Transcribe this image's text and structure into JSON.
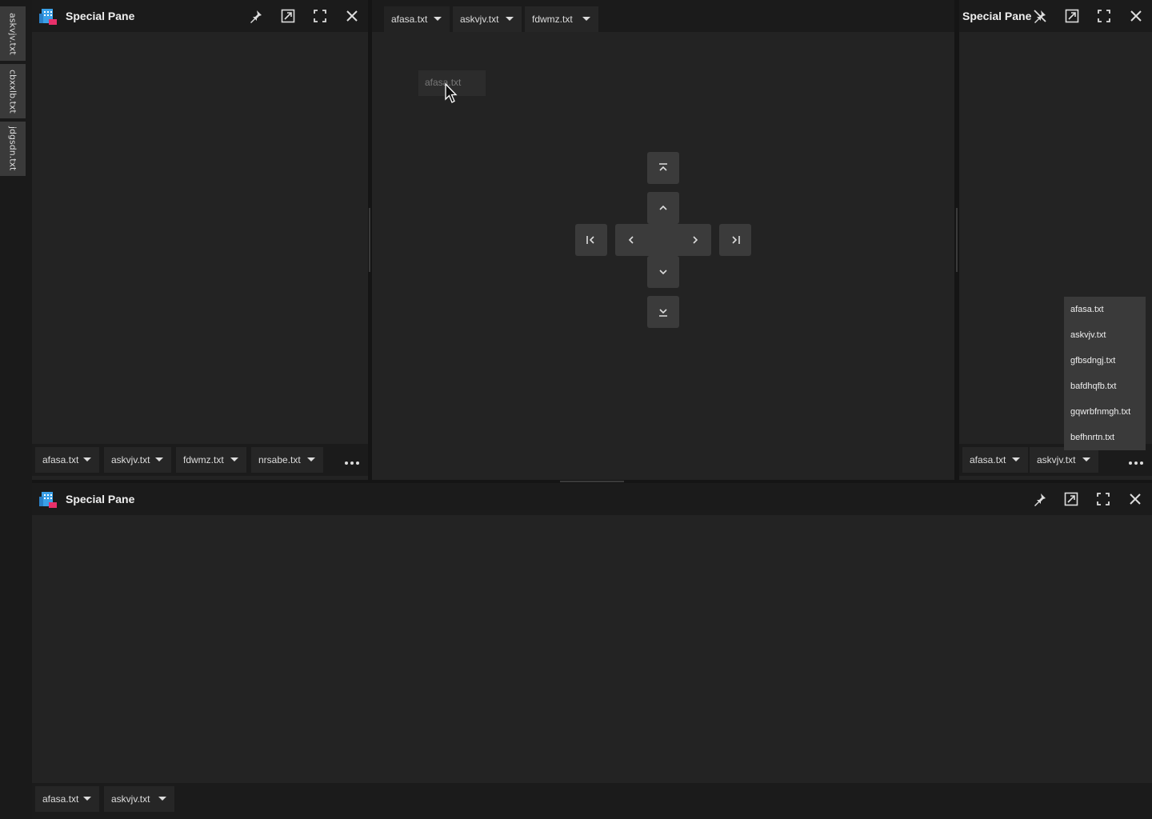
{
  "colors": {
    "background": "#151515",
    "pane": "#232323",
    "header": "#1b1b1b",
    "tab": "#262626",
    "guide": "#3b3b3b",
    "menu": "#3a3a3a"
  },
  "sidebar": {
    "tabs": [
      "askvjv.txt",
      "cbxxlb.txt",
      "jdgsdn.txt"
    ]
  },
  "pane_left": {
    "title": "Special Pane",
    "tabs": [
      "afasa.txt",
      "askvjv.txt",
      "fdwmz.txt",
      "nrsabe.txt"
    ]
  },
  "pane_center": {
    "tabs": [
      "afasa.txt",
      "askvjv.txt",
      "fdwmz.txt"
    ],
    "drag_ghost": "afasa.txt"
  },
  "pane_right": {
    "title": "Special Pane",
    "tabs": [
      "afasa.txt",
      "askvjv.txt"
    ],
    "dropdown": [
      "afasa.txt",
      "askvjv.txt",
      "gfbsdngj.txt",
      "bafdhqfb.txt",
      "gqwrbfnmgh.txt",
      "befhnrtn.txt"
    ]
  },
  "pane_bottom": {
    "title": "Special Pane",
    "tabs": [
      "afasa.txt",
      "askvjv.txt"
    ]
  },
  "icons": {
    "header": [
      "app-icon",
      "pin-icon",
      "float-icon",
      "maximize-icon",
      "close-icon"
    ],
    "dock_guides": [
      "dock-top-edge-icon",
      "dock-up-icon",
      "dock-left-edge-icon",
      "dock-left-icon",
      "dock-right-icon",
      "dock-right-edge-icon",
      "dock-down-icon",
      "dock-bottom-edge-icon"
    ]
  }
}
